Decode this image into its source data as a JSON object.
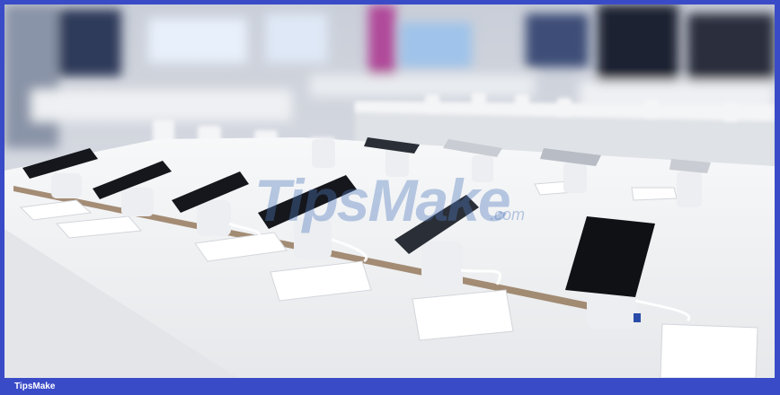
{
  "footer": {
    "brand": "TipsMake"
  },
  "watermark": {
    "name": "TipsMake",
    "suffix": ".com"
  },
  "colors": {
    "frame": "#3a4bc8",
    "table": "#f2f3f5",
    "phone": "#15171c",
    "stand": "#e9ebee"
  }
}
